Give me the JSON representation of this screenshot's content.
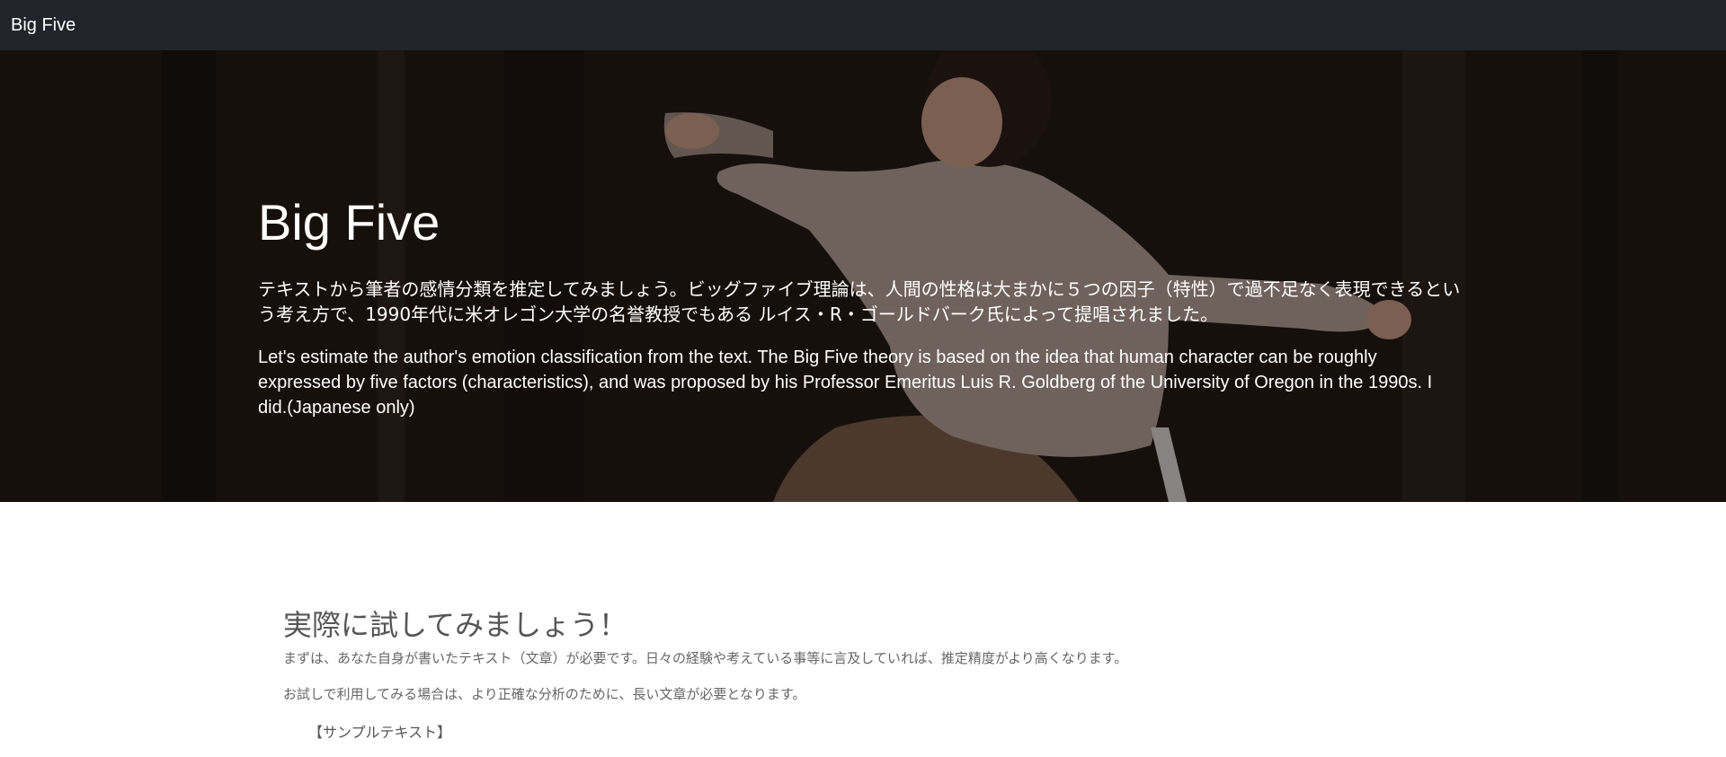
{
  "navbar": {
    "brand": "Big Five"
  },
  "hero": {
    "title": "Big Five",
    "description_ja": "テキストから筆者の感情分類を推定してみましょう。ビッグファイブ理論は、人間の性格は大まかに５つの因子（特性）で過不足なく表現できるという考え方で、1990年代に米オレゴン大学の名誉教授でもある ルイス・R・ゴールドバーク氏によって提唱されました。",
    "description_en": "Let's estimate the author's emotion classification from the text. The Big Five theory is based on the idea that human character can be roughly expressed by five factors (characteristics), and was proposed by his Professor Emeritus Luis R. Goldberg of the University of Oregon in the 1990s. I did.(Japanese only)"
  },
  "main": {
    "heading": "実際に試してみましょう！",
    "paragraph1": "まずは、あなた自身が書いたテキスト（文章）が必要です。日々の経験や考えている事等に言及していれば、推定精度がより高くなります。",
    "paragraph2": "お試しで利用してみる場合は、より正確な分析のために、長い文章が必要となります。",
    "sample_label": "【サンプルテキスト】"
  }
}
